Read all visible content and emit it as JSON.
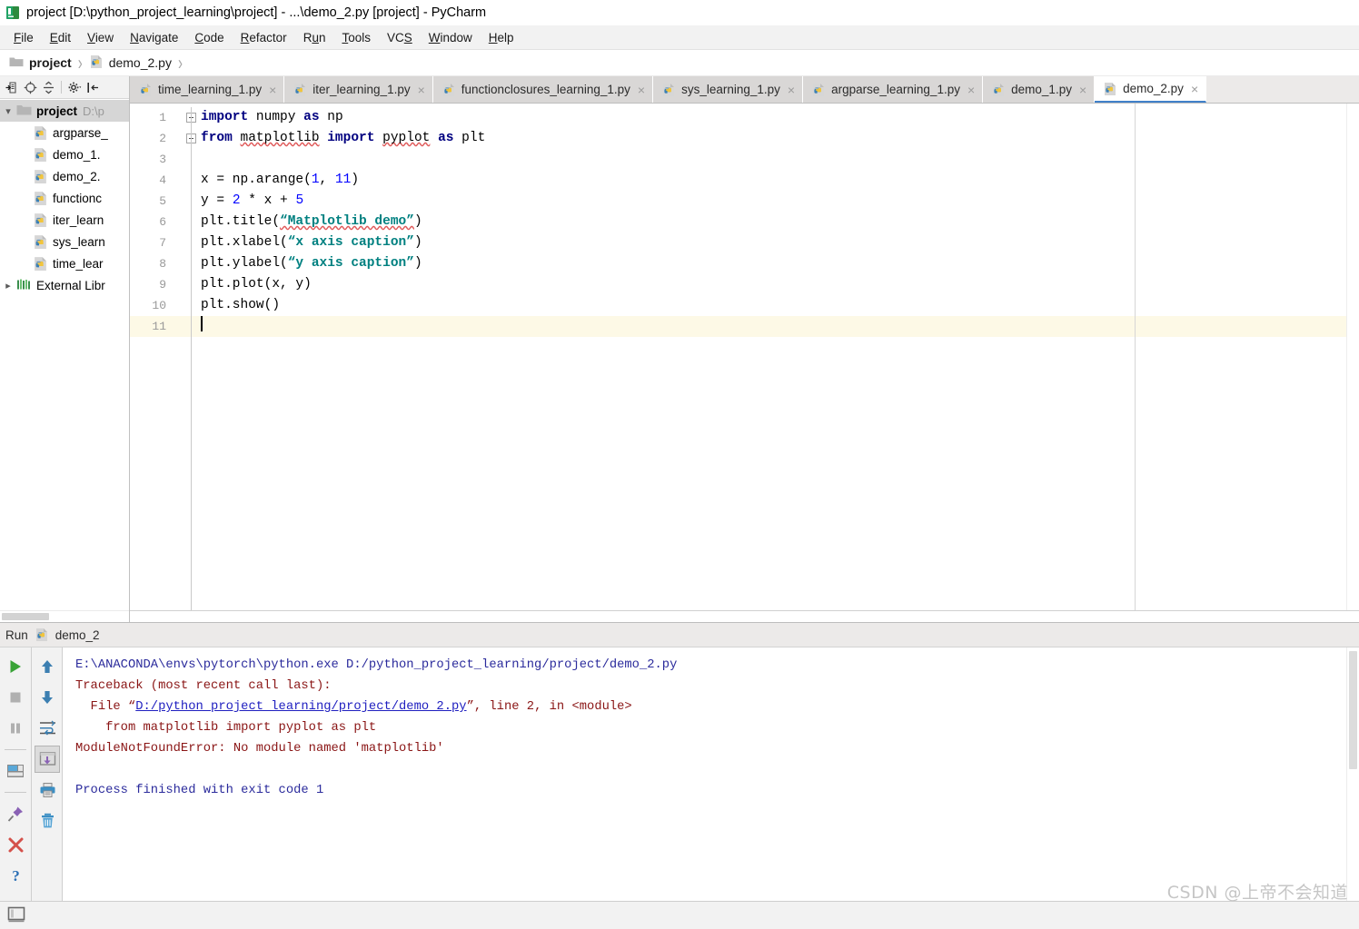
{
  "window": {
    "title": "project [D:\\python_project_learning\\project] - ...\\demo_2.py [project] - PyCharm",
    "app_icon": "pycharm-icon"
  },
  "menubar": {
    "items": [
      {
        "label": "File",
        "mnemonic": "F"
      },
      {
        "label": "Edit",
        "mnemonic": "E"
      },
      {
        "label": "View",
        "mnemonic": "V"
      },
      {
        "label": "Navigate",
        "mnemonic": "N"
      },
      {
        "label": "Code",
        "mnemonic": "C"
      },
      {
        "label": "Refactor",
        "mnemonic": "R"
      },
      {
        "label": "Run",
        "mnemonic": "u"
      },
      {
        "label": "Tools",
        "mnemonic": "T"
      },
      {
        "label": "VCS",
        "mnemonic": "S"
      },
      {
        "label": "Window",
        "mnemonic": "W"
      },
      {
        "label": "Help",
        "mnemonic": "H"
      }
    ]
  },
  "breadcrumb": {
    "items": [
      {
        "label": "project",
        "icon": "folder-icon",
        "bold": true
      },
      {
        "label": "demo_2.py",
        "icon": "python-file-icon",
        "bold": false
      }
    ],
    "separator": "›"
  },
  "project_toolbar": {
    "buttons": [
      {
        "name": "jump-to-source-icon",
        "title": "Select Opened File"
      },
      {
        "name": "locate-icon",
        "title": "Scroll from Source"
      },
      {
        "name": "collapse-all-icon",
        "title": "Collapse All"
      },
      {
        "name": "settings-gear-icon",
        "title": "Settings"
      },
      {
        "name": "hide-panel-icon",
        "title": "Hide"
      }
    ]
  },
  "project_tree": {
    "rows": [
      {
        "label": "project",
        "path": "D:\\p",
        "icon": "folder-icon",
        "depth": 0,
        "expanded": true,
        "bold": true,
        "selected": true
      },
      {
        "label": "argparse_",
        "icon": "python-file-icon",
        "depth": 1,
        "bold": false,
        "selected": false
      },
      {
        "label": "demo_1.",
        "icon": "python-file-icon",
        "depth": 1,
        "bold": false,
        "selected": false
      },
      {
        "label": "demo_2.",
        "icon": "python-file-icon",
        "depth": 1,
        "bold": false,
        "selected": false
      },
      {
        "label": "functionc",
        "icon": "python-file-icon",
        "depth": 1,
        "bold": false,
        "selected": false
      },
      {
        "label": "iter_learn",
        "icon": "python-file-icon",
        "depth": 1,
        "bold": false,
        "selected": false
      },
      {
        "label": "sys_learn",
        "icon": "python-file-icon",
        "depth": 1,
        "bold": false,
        "selected": false
      },
      {
        "label": "time_lear",
        "icon": "python-file-icon",
        "depth": 1,
        "bold": false,
        "selected": false
      },
      {
        "label": "External Libr",
        "icon": "library-icon",
        "depth": 0,
        "expanded": false,
        "bold": false,
        "selected": false
      }
    ]
  },
  "editor_tabs": [
    {
      "label": "time_learning_1.py",
      "icon": "python-file-icon",
      "active": false,
      "close": "×"
    },
    {
      "label": "iter_learning_1.py",
      "icon": "python-file-icon",
      "active": false,
      "close": "×"
    },
    {
      "label": "functionclosures_learning_1.py",
      "icon": "python-file-icon",
      "active": false,
      "close": "×"
    },
    {
      "label": "sys_learning_1.py",
      "icon": "python-file-icon",
      "active": false,
      "close": "×"
    },
    {
      "label": "argparse_learning_1.py",
      "icon": "python-file-icon",
      "active": false,
      "close": "×"
    },
    {
      "label": "demo_1.py",
      "icon": "python-file-icon",
      "active": false,
      "close": "×"
    },
    {
      "label": "demo_2.py",
      "icon": "python-file-icon",
      "active": true,
      "close": "×"
    }
  ],
  "editor": {
    "current_line": 11,
    "line_numbers": [
      "1",
      "2",
      "3",
      "4",
      "5",
      "6",
      "7",
      "8",
      "9",
      "10",
      "11"
    ],
    "lines": [
      {
        "n": 1,
        "text": "import numpy as np"
      },
      {
        "n": 2,
        "text": "from matplotlib import pyplot as plt"
      },
      {
        "n": 3,
        "text": ""
      },
      {
        "n": 4,
        "text": "x = np.arange(1, 11)"
      },
      {
        "n": 5,
        "text": "y = 2 * x + 5"
      },
      {
        "n": 6,
        "text": "plt.title(“Matplotlib demo”)"
      },
      {
        "n": 7,
        "text": "plt.xlabel(“x axis caption”)"
      },
      {
        "n": 8,
        "text": "plt.ylabel(“y axis caption”)"
      },
      {
        "n": 9,
        "text": "plt.plot(x, y)"
      },
      {
        "n": 10,
        "text": "plt.show()"
      },
      {
        "n": 11,
        "text": ""
      }
    ]
  },
  "run_panel": {
    "title": "Run",
    "config_name": "demo_2",
    "config_icon": "python-file-icon",
    "tools_left": [
      {
        "name": "run-button-icon",
        "glyph": "play",
        "color": "#39a337"
      },
      {
        "name": "stop-button-icon",
        "glyph": "stop",
        "color": "#a8a8a8"
      },
      {
        "name": "pause-button-icon",
        "glyph": "pause",
        "color": "#a8a8a8"
      },
      {
        "name": "restore-layout-icon",
        "glyph": "layout",
        "color": "#3c7fb1"
      },
      {
        "name": "pin-tab-icon",
        "glyph": "pin",
        "color": "#8a62b5"
      },
      {
        "name": "close-tab-icon",
        "glyph": "close",
        "color": "#d4504a"
      },
      {
        "name": "help-icon",
        "glyph": "question",
        "color": "#2b6fb5"
      }
    ],
    "tools_right": [
      {
        "name": "up-the-stack-trace-icon",
        "glyph": "arrow-up",
        "color": "#3c7fb1"
      },
      {
        "name": "down-the-stack-trace-icon",
        "glyph": "arrow-down",
        "color": "#3c7fb1"
      },
      {
        "name": "soft-wrap-icon",
        "glyph": "wrap",
        "color": "#555555"
      },
      {
        "name": "scroll-to-end-icon",
        "glyph": "scroll-end",
        "color": "#8a62b5",
        "pressed": true
      },
      {
        "name": "print-icon",
        "glyph": "print",
        "color": "#3c7fb1"
      },
      {
        "name": "clear-all-icon",
        "glyph": "trash",
        "color": "#3c7fb1"
      }
    ],
    "console_lines": [
      {
        "kind": "cmd",
        "text": "E:\\ANACONDA\\envs\\pytorch\\python.exe D:/python_project_learning/project/demo_2.py"
      },
      {
        "kind": "err",
        "text": "Traceback (most recent call last):"
      },
      {
        "kind": "err-link",
        "prefix": "  File “",
        "link": "D:/python_project_learning/project/demo_2.py",
        "suffix": "”, line 2, in <module>"
      },
      {
        "kind": "err",
        "text": "    from matplotlib import pyplot as plt"
      },
      {
        "kind": "err",
        "text": "ModuleNotFoundError: No module named 'matplotlib'"
      },
      {
        "kind": "blank",
        "text": ""
      },
      {
        "kind": "done",
        "text": "Process finished with exit code 1"
      }
    ]
  },
  "statusbar": {
    "layout_icon": "restore-layout-icon"
  },
  "watermark": {
    "text": "CSDN @上帝不会知道"
  },
  "colors": {
    "accent": "#4080c9",
    "keyword": "#000080",
    "string": "#008080",
    "number": "#0000ff",
    "error": "#8a1515",
    "link": "#2020c0",
    "current_line_bg": "#fdf9e6"
  }
}
